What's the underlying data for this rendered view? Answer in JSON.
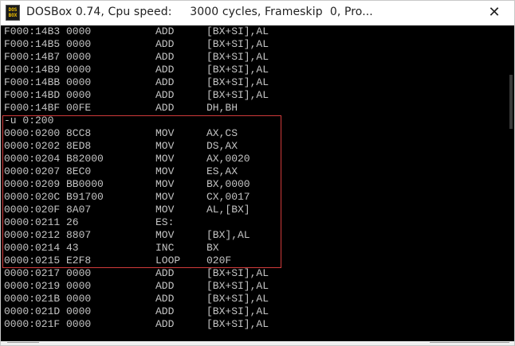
{
  "window": {
    "title": "DOSBox 0.74, Cpu speed:     3000 cycles, Frameskip  0, Pro...",
    "icon_text": "DOS BOX",
    "close_glyph": "✕"
  },
  "console": {
    "top_lines": [
      {
        "addr": "F000:14B3",
        "code": "0000",
        "op": "ADD",
        "args": "[BX+SI],AL"
      },
      {
        "addr": "F000:14B5",
        "code": "0000",
        "op": "ADD",
        "args": "[BX+SI],AL"
      },
      {
        "addr": "F000:14B7",
        "code": "0000",
        "op": "ADD",
        "args": "[BX+SI],AL"
      },
      {
        "addr": "F000:14B9",
        "code": "0000",
        "op": "ADD",
        "args": "[BX+SI],AL"
      },
      {
        "addr": "F000:14BB",
        "code": "0000",
        "op": "ADD",
        "args": "[BX+SI],AL"
      },
      {
        "addr": "F000:14BD",
        "code": "0000",
        "op": "ADD",
        "args": "[BX+SI],AL"
      },
      {
        "addr": "F000:14BF",
        "code": "00FE",
        "op": "ADD",
        "args": "DH,BH"
      }
    ],
    "command": "-u 0:200",
    "highlight_lines": [
      {
        "addr": "0000:0200",
        "code": "8CC8",
        "op": "MOV",
        "args": "AX,CS"
      },
      {
        "addr": "0000:0202",
        "code": "8ED8",
        "op": "MOV",
        "args": "DS,AX"
      },
      {
        "addr": "0000:0204",
        "code": "B82000",
        "op": "MOV",
        "args": "AX,0020"
      },
      {
        "addr": "0000:0207",
        "code": "8EC0",
        "op": "MOV",
        "args": "ES,AX"
      },
      {
        "addr": "0000:0209",
        "code": "BB0000",
        "op": "MOV",
        "args": "BX,0000"
      },
      {
        "addr": "0000:020C",
        "code": "B91700",
        "op": "MOV",
        "args": "CX,0017"
      },
      {
        "addr": "0000:020F",
        "code": "8A07",
        "op": "MOV",
        "args": "AL,[BX]"
      },
      {
        "addr": "0000:0211",
        "code": "26",
        "op": "ES:",
        "args": ""
      },
      {
        "addr": "0000:0212",
        "code": "8807",
        "op": "MOV",
        "args": "[BX],AL"
      },
      {
        "addr": "0000:0214",
        "code": "43",
        "op": "INC",
        "args": "BX"
      },
      {
        "addr": "0000:0215",
        "code": "E2F8",
        "op": "LOOP",
        "args": "020F"
      }
    ],
    "bottom_lines": [
      {
        "addr": "0000:0217",
        "code": "0000",
        "op": "ADD",
        "args": "[BX+SI],AL"
      },
      {
        "addr": "0000:0219",
        "code": "0000",
        "op": "ADD",
        "args": "[BX+SI],AL"
      },
      {
        "addr": "0000:021B",
        "code": "0000",
        "op": "ADD",
        "args": "[BX+SI],AL"
      },
      {
        "addr": "0000:021D",
        "code": "0000",
        "op": "ADD",
        "args": "[BX+SI],AL"
      },
      {
        "addr": "0000:021F",
        "code": "0000",
        "op": "ADD",
        "args": "[BX+SI],AL"
      }
    ]
  },
  "colors": {
    "console_bg": "#000000",
    "console_text": "#c4c4c4",
    "highlight_border": "#d03a3a"
  }
}
